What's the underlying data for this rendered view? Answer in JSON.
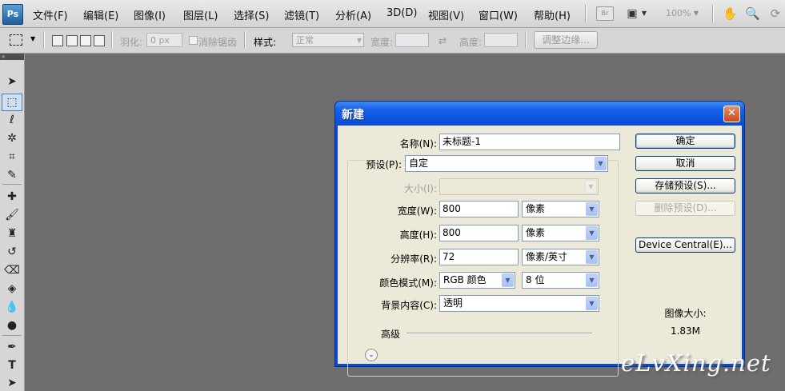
{
  "app": {
    "logo": "Ps"
  },
  "menubar": {
    "items": [
      "文件(F)",
      "编辑(E)",
      "图像(I)",
      "图层(L)",
      "选择(S)",
      "滤镜(T)",
      "分析(A)",
      "3D(D)",
      "视图(V)",
      "窗口(W)",
      "帮助(H)"
    ],
    "bridge_label": "Br",
    "zoom": "100%"
  },
  "options": {
    "feather_label": "羽化:",
    "feather_value": "0 px",
    "antialias_label": "消除锯齿",
    "style_label": "样式:",
    "style_value": "正常",
    "width_label": "宽度:",
    "height_label": "高度:",
    "refine_edge": "调整边缘..."
  },
  "dialog": {
    "title": "新建",
    "name_label": "名称(N):",
    "name_value": "未标题-1",
    "preset_label": "预设(P):",
    "preset_value": "自定",
    "size_label": "大小(I):",
    "width_label": "宽度(W):",
    "width_value": "800",
    "width_unit": "像素",
    "height_label": "高度(H):",
    "height_value": "800",
    "height_unit": "像素",
    "resolution_label": "分辨率(R):",
    "resolution_value": "72",
    "resolution_unit": "像素/英寸",
    "color_mode_label": "颜色模式(M):",
    "color_mode_value": "RGB 颜色",
    "bit_depth_value": "8 位",
    "background_label": "背景内容(C):",
    "background_value": "透明",
    "advanced_label": "高级",
    "buttons": {
      "ok": "确定",
      "cancel": "取消",
      "save_preset": "存储预设(S)...",
      "delete_preset": "删除预设(D)...",
      "device_central": "Device Central(E)..."
    },
    "image_size_label": "图像大小:",
    "image_size_value": "1.83M"
  },
  "watermark": "eLvXing.net",
  "colors": {
    "titlebar": "#0c56e2",
    "workspace": "#6e6e6e",
    "dialog_bg": "#ece9d8"
  }
}
